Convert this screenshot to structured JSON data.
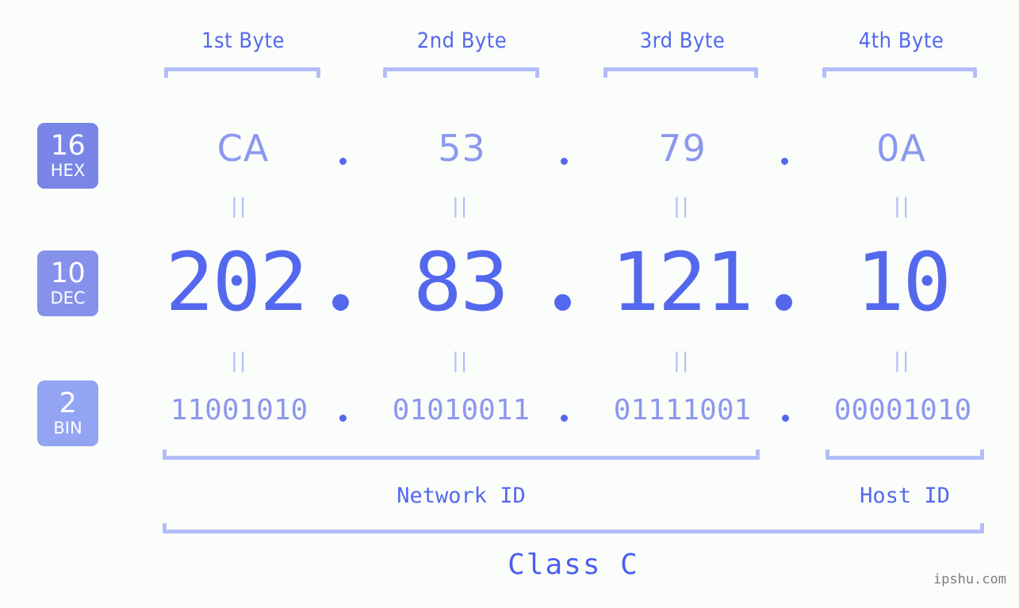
{
  "background_color": "#fbfdfa",
  "accent_dark": "#5468ee",
  "accent_mid": "#8b98ef",
  "accent_light": "#b3bdfa",
  "byte_headers": [
    {
      "label": "1st Byte"
    },
    {
      "label": "2nd Byte"
    },
    {
      "label": "3rd Byte"
    },
    {
      "label": "4th Byte"
    }
  ],
  "bases": [
    {
      "number": "16",
      "name": "HEX",
      "color": "#7986e8"
    },
    {
      "number": "10",
      "name": "DEC",
      "color": "#8691ec"
    },
    {
      "number": "2",
      "name": "BIN",
      "color": "#92a4f2"
    }
  ],
  "rows": {
    "hex": {
      "base_number": "16",
      "base_name": "HEX",
      "values": [
        "CA",
        "53",
        "79",
        "0A"
      ],
      "separator": "."
    },
    "dec": {
      "base_number": "10",
      "base_name": "DEC",
      "values": [
        "202",
        "83",
        "121",
        "10"
      ],
      "separator": "."
    },
    "bin": {
      "base_number": "2",
      "base_name": "BIN",
      "values": [
        "11001010",
        "01010011",
        "01111001",
        "00001010"
      ],
      "separator": "."
    }
  },
  "equality_marker": "||",
  "segments": {
    "network_id": "Network ID",
    "host_id": "Host ID"
  },
  "class_label": "Class C",
  "watermark": "ipshu.com"
}
